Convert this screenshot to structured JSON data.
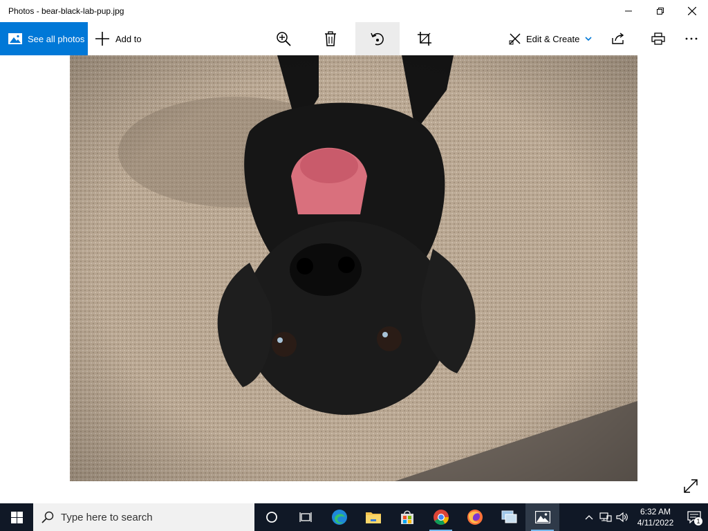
{
  "window": {
    "title": "Photos - bear-black-lab-pup.jpg",
    "minimize_icon": "minimize-icon",
    "maximize_icon": "restore-icon",
    "close_icon": "close-icon"
  },
  "commandbar": {
    "see_all_photos": "See all photos",
    "add_to": "Add to",
    "zoom_icon": "zoom-in-icon",
    "delete_icon": "trash-icon",
    "rotate_icon": "rotate-icon",
    "crop_icon": "crop-icon",
    "edit_create": "Edit & Create",
    "share_icon": "share-icon",
    "print_icon": "print-icon",
    "more_icon": "more-icon",
    "accent_color": "#0078d7"
  },
  "photo": {
    "subject": "black-lab-puppy",
    "expand_icon": "expand-icon"
  },
  "taskbar": {
    "search_placeholder": "Type here to search",
    "time": "6:32 AM",
    "date": "4/11/2022",
    "notification_count": "1",
    "apps": [
      "cortana",
      "task-view",
      "edge",
      "file-explorer",
      "store",
      "chrome",
      "firefox",
      "network-app",
      "photos"
    ]
  }
}
